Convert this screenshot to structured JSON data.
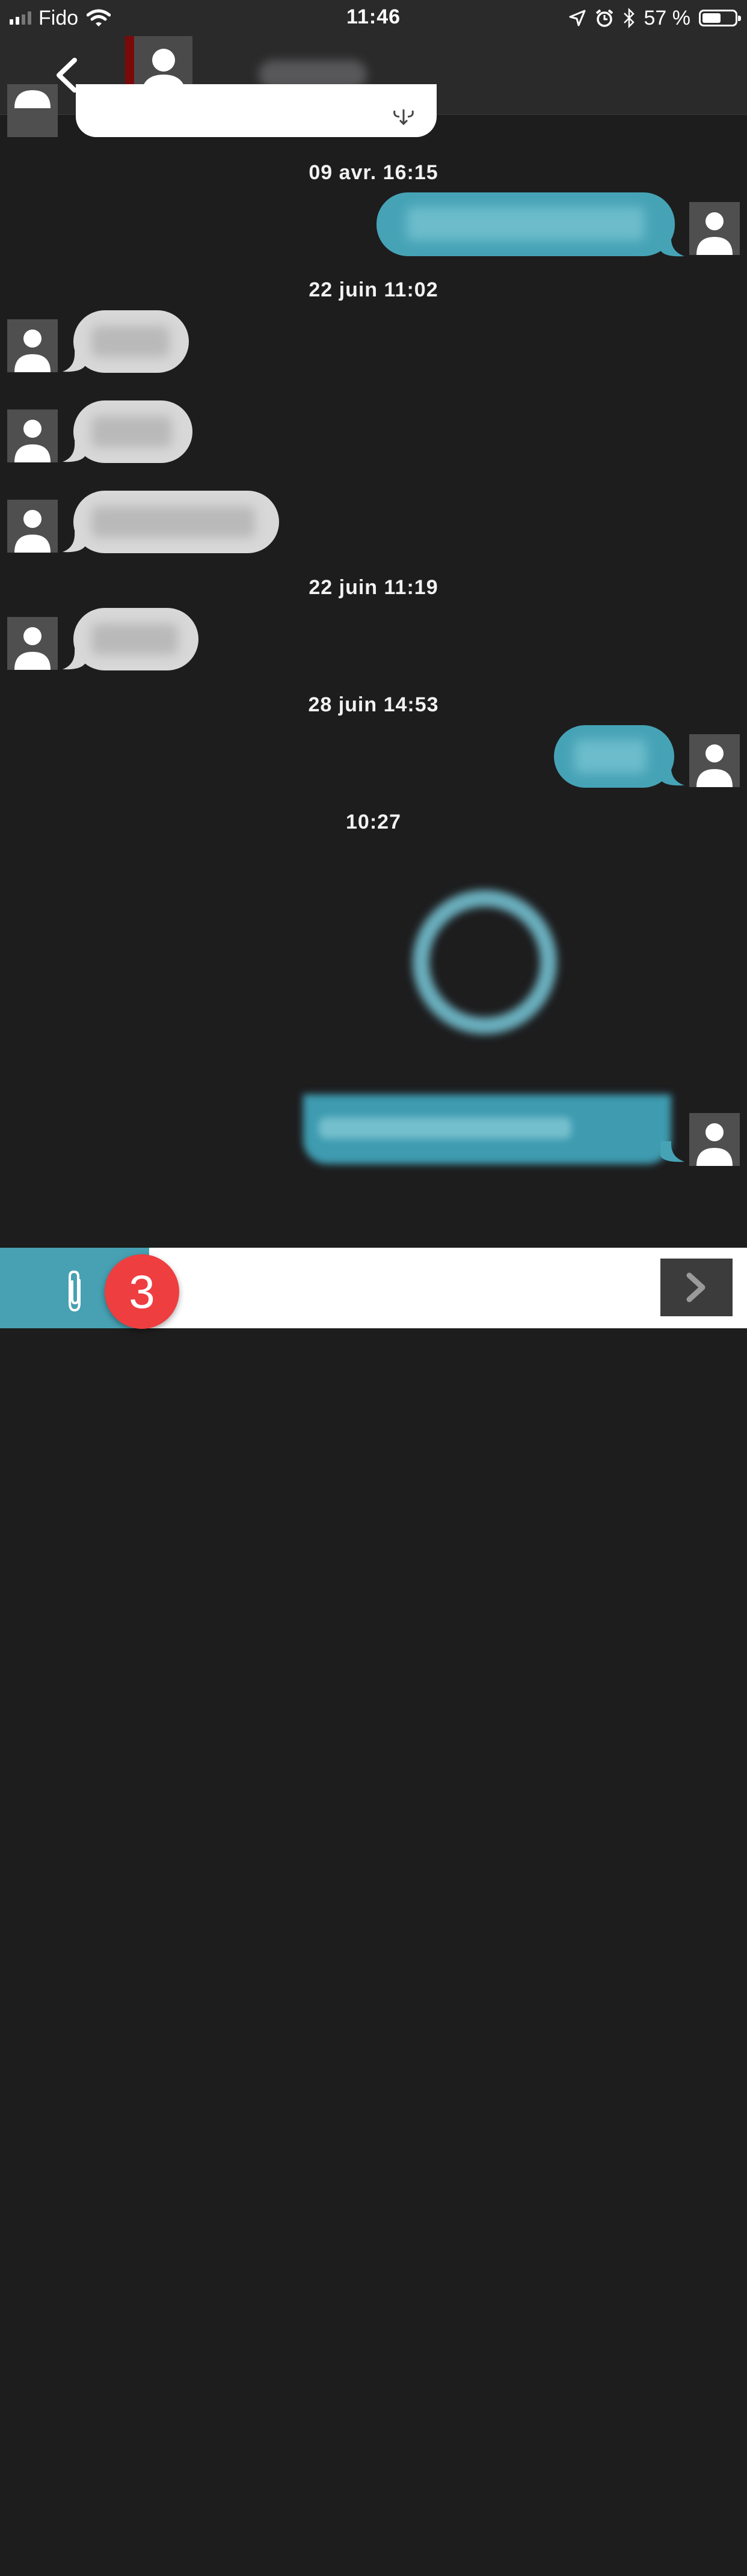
{
  "status_bar": {
    "carrier": "Fido",
    "time": "11:46",
    "battery_text": "57 %",
    "battery_level": 0.57,
    "icons": [
      "signal-icon",
      "wifi-icon",
      "location-icon",
      "alarm-icon",
      "bluetooth-icon",
      "battery-icon"
    ]
  },
  "header": {
    "back_icon": "chevron-left-icon",
    "avatar_icon": "person-icon",
    "contact_name": ""
  },
  "conversation": {
    "timestamps": [
      "09 avr. 16:15",
      "22 juin 11:02",
      "22 juin 11:19",
      "28 juin 14:53",
      "10:27"
    ],
    "messages": [
      {
        "direction": "incoming",
        "text": ""
      },
      {
        "direction": "outgoing",
        "text": ""
      },
      {
        "direction": "incoming",
        "text": ""
      },
      {
        "direction": "incoming",
        "text": ""
      },
      {
        "direction": "incoming",
        "text": ""
      },
      {
        "direction": "incoming",
        "text": ""
      },
      {
        "direction": "outgoing",
        "text": ""
      },
      {
        "direction": "outgoing",
        "text": "",
        "kind": "image"
      }
    ]
  },
  "composer": {
    "attach_icon": "paperclip-icon",
    "badge_count": "3",
    "input_value": "",
    "send_icon": "chevron-right-icon"
  },
  "colors": {
    "background": "#1d1d1e",
    "bar": "#2a2a2b",
    "outgoing_bubble": "#46a3b6",
    "incoming_bubble": "#d8d8d8",
    "badge": "#ee3e40"
  }
}
